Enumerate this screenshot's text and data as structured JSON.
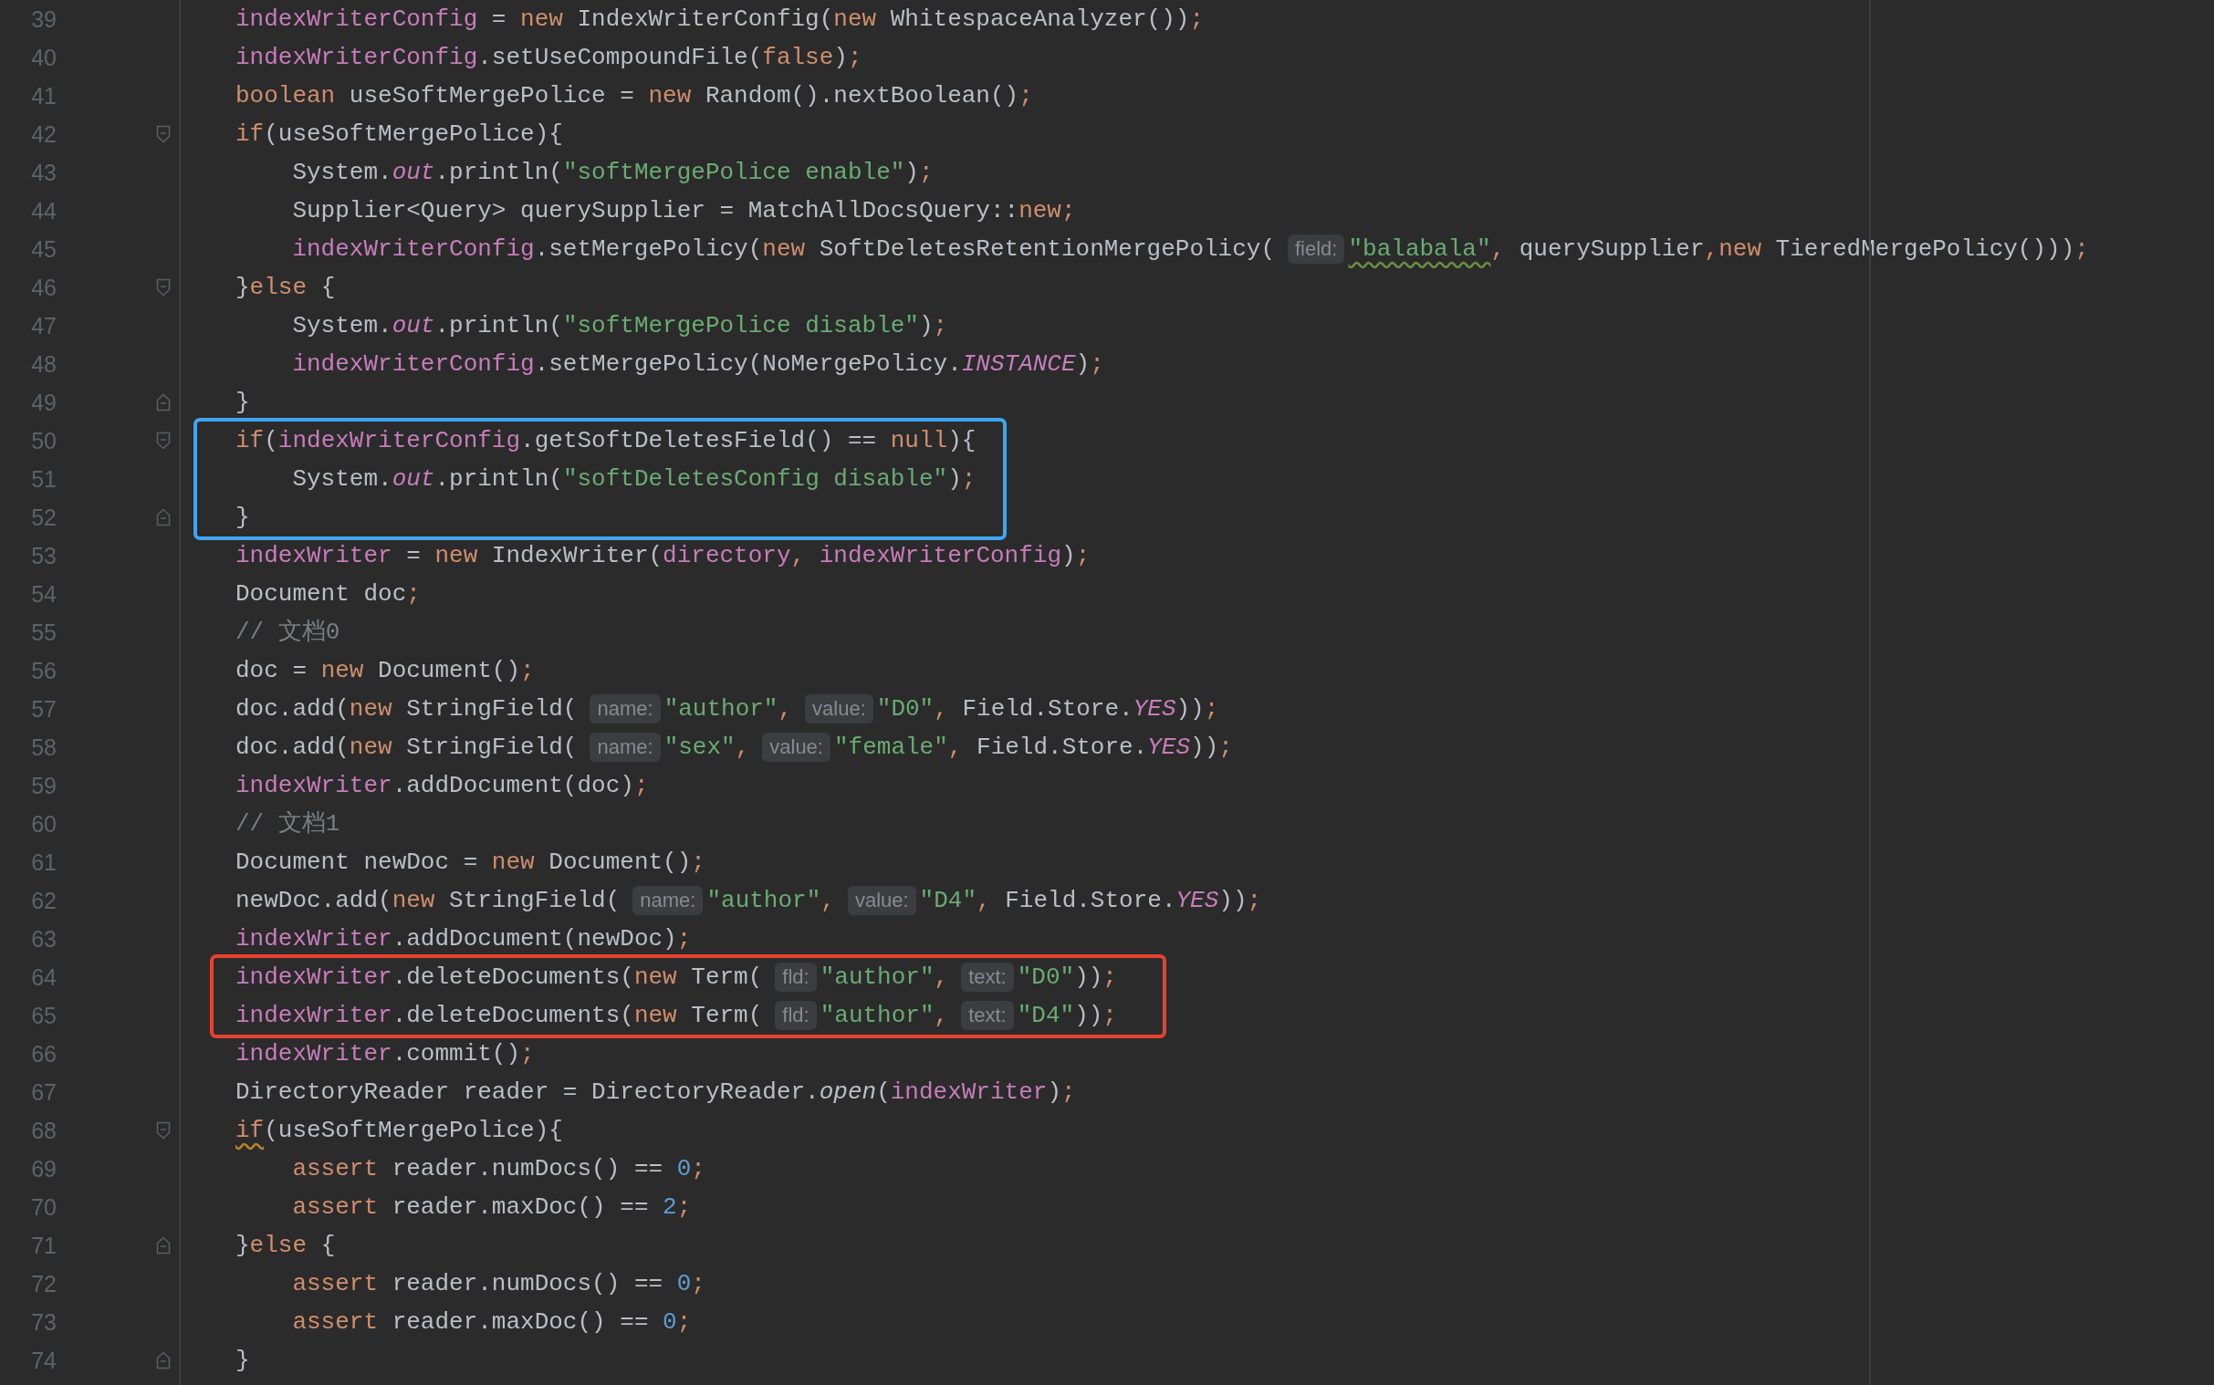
{
  "blocks": [
    {
      "kind": "plain",
      "lines": [
        {
          "number": "39",
          "kind": "code",
          "tokens": [
            {
              "kind": "field",
              "text": "indexWriterConfig"
            },
            {
              "kind": "plain",
              "text": " = "
            },
            {
              "kind": "kw",
              "text": "new"
            },
            {
              "kind": "plain",
              "text": " IndexWriterConfig("
            },
            {
              "kind": "kw",
              "text": "new"
            },
            {
              "kind": "plain",
              "text": " WhitespaceAnalyzer())"
            },
            {
              "kind": "punct",
              "text": ";"
            }
          ]
        },
        {
          "number": "40",
          "kind": "code",
          "tokens": [
            {
              "kind": "field",
              "text": "indexWriterConfig"
            },
            {
              "kind": "plain",
              "text": ".setUseCompoundFile("
            },
            {
              "kind": "kw",
              "text": "false"
            },
            {
              "kind": "plain",
              "text": ")"
            },
            {
              "kind": "punct",
              "text": ";"
            }
          ]
        },
        {
          "number": "41",
          "kind": "code",
          "tokens": [
            {
              "kind": "kw",
              "text": "boolean"
            },
            {
              "kind": "plain",
              "text": " useSoftMergePolice = "
            },
            {
              "kind": "kw",
              "text": "new"
            },
            {
              "kind": "plain",
              "text": " Random().nextBoolean()"
            },
            {
              "kind": "punct",
              "text": ";"
            }
          ]
        },
        {
          "number": "42",
          "kind": "fold_start",
          "tokens": [
            {
              "kind": "kw",
              "text": "if"
            },
            {
              "kind": "plain",
              "text": "(useSoftMergePolice){"
            }
          ]
        },
        {
          "number": "43",
          "kind": "code",
          "tokens": [
            {
              "kind": "plain",
              "text": "    System."
            },
            {
              "kind": "static",
              "text": "out"
            },
            {
              "kind": "plain",
              "text": ".println("
            },
            {
              "kind": "str",
              "text": "\"softMergePolice enable\""
            },
            {
              "kind": "plain",
              "text": ")"
            },
            {
              "kind": "punct",
              "text": ";"
            }
          ]
        },
        {
          "number": "44",
          "kind": "code",
          "tokens": [
            {
              "kind": "plain",
              "text": "    Supplier<Query> querySupplier = MatchAllDocsQuery::"
            },
            {
              "kind": "kw",
              "text": "new"
            },
            {
              "kind": "punct",
              "text": ";"
            }
          ]
        },
        {
          "number": "45",
          "kind": "code",
          "tokens": [
            {
              "kind": "field",
              "text": "    indexWriterConfig"
            },
            {
              "kind": "plain",
              "text": ".setMergePolicy("
            },
            {
              "kind": "kw",
              "text": "new"
            },
            {
              "kind": "plain",
              "text": " SoftDeletesRetentionMergePolicy("
            },
            {
              "kind": "hint",
              "text": "field:"
            },
            {
              "kind": "str_typo",
              "text": "\"balabala\""
            },
            {
              "kind": "punct",
              "text": ", "
            },
            {
              "kind": "plain",
              "text": "querySupplier"
            },
            {
              "kind": "punct",
              "text": ","
            },
            {
              "kind": "kw",
              "text": "new"
            },
            {
              "kind": "plain",
              "text": " TieredMergePolicy()))"
            },
            {
              "kind": "punct",
              "text": ";"
            }
          ]
        },
        {
          "number": "46",
          "kind": "fold_start",
          "tokens": [
            {
              "kind": "plain",
              "text": "}"
            },
            {
              "kind": "kw",
              "text": "else"
            },
            {
              "kind": "plain",
              "text": " {"
            }
          ]
        },
        {
          "number": "47",
          "kind": "code",
          "tokens": [
            {
              "kind": "plain",
              "text": "    System."
            },
            {
              "kind": "static",
              "text": "out"
            },
            {
              "kind": "plain",
              "text": ".println("
            },
            {
              "kind": "str",
              "text": "\"softMergePolice disable\""
            },
            {
              "kind": "plain",
              "text": ")"
            },
            {
              "kind": "punct",
              "text": ";"
            }
          ]
        },
        {
          "number": "48",
          "kind": "code",
          "tokens": [
            {
              "kind": "field",
              "text": "    indexWriterConfig"
            },
            {
              "kind": "plain",
              "text": ".setMergePolicy(NoMergePolicy."
            },
            {
              "kind": "static",
              "text": "INSTANCE"
            },
            {
              "kind": "plain",
              "text": ")"
            },
            {
              "kind": "punct",
              "text": ";"
            }
          ]
        },
        {
          "number": "49",
          "kind": "fold_end",
          "tokens": [
            {
              "kind": "plain",
              "text": "}"
            }
          ]
        }
      ]
    },
    {
      "kind": "highlight",
      "color": "#3ea6f2",
      "lines": [
        {
          "number": "50",
          "kind": "fold_start",
          "tokens": [
            {
              "kind": "kw",
              "text": "if"
            },
            {
              "kind": "plain",
              "text": "("
            },
            {
              "kind": "field",
              "text": "indexWriterConfig"
            },
            {
              "kind": "plain",
              "text": ".getSoftDeletesField() == "
            },
            {
              "kind": "kw",
              "text": "null"
            },
            {
              "kind": "plain",
              "text": "){"
            }
          ]
        },
        {
          "number": "51",
          "kind": "code",
          "tokens": [
            {
              "kind": "plain",
              "text": "    System."
            },
            {
              "kind": "static",
              "text": "out"
            },
            {
              "kind": "plain",
              "text": ".println("
            },
            {
              "kind": "str",
              "text": "\"softDeletesConfig disable\""
            },
            {
              "kind": "plain",
              "text": ")"
            },
            {
              "kind": "punct",
              "text": ";"
            }
          ]
        },
        {
          "number": "52",
          "kind": "fold_end",
          "tokens": [
            {
              "kind": "plain",
              "text": "}"
            }
          ]
        }
      ]
    },
    {
      "kind": "plain",
      "lines": [
        {
          "number": "53",
          "kind": "code",
          "tokens": [
            {
              "kind": "field",
              "text": "indexWriter"
            },
            {
              "kind": "plain",
              "text": " = "
            },
            {
              "kind": "kw",
              "text": "new"
            },
            {
              "kind": "plain",
              "text": " IndexWriter("
            },
            {
              "kind": "field",
              "text": "directory"
            },
            {
              "kind": "punct",
              "text": ", "
            },
            {
              "kind": "field",
              "text": "indexWriterConfig"
            },
            {
              "kind": "plain",
              "text": ")"
            },
            {
              "kind": "punct",
              "text": ";"
            }
          ]
        },
        {
          "number": "54",
          "kind": "code",
          "tokens": [
            {
              "kind": "plain",
              "text": "Document doc"
            },
            {
              "kind": "punct",
              "text": ";"
            }
          ]
        },
        {
          "number": "55",
          "kind": "code",
          "tokens": [
            {
              "kind": "comment",
              "text": "// 文档0"
            }
          ]
        },
        {
          "number": "56",
          "kind": "code",
          "tokens": [
            {
              "kind": "plain",
              "text": "doc = "
            },
            {
              "kind": "kw",
              "text": "new"
            },
            {
              "kind": "plain",
              "text": " Document()"
            },
            {
              "kind": "punct",
              "text": ";"
            }
          ]
        },
        {
          "number": "57",
          "kind": "code",
          "tokens": [
            {
              "kind": "plain",
              "text": "doc.add("
            },
            {
              "kind": "kw",
              "text": "new"
            },
            {
              "kind": "plain",
              "text": " StringField("
            },
            {
              "kind": "hint",
              "text": "name:"
            },
            {
              "kind": "str",
              "text": "\"author\""
            },
            {
              "kind": "punct",
              "text": ","
            },
            {
              "kind": "hint",
              "text": "value:"
            },
            {
              "kind": "str",
              "text": "\"D0\""
            },
            {
              "kind": "punct",
              "text": ", "
            },
            {
              "kind": "plain",
              "text": "Field.Store."
            },
            {
              "kind": "static",
              "text": "YES"
            },
            {
              "kind": "plain",
              "text": "))"
            },
            {
              "kind": "punct",
              "text": ";"
            }
          ]
        },
        {
          "number": "58",
          "kind": "code",
          "tokens": [
            {
              "kind": "plain",
              "text": "doc.add("
            },
            {
              "kind": "kw",
              "text": "new"
            },
            {
              "kind": "plain",
              "text": " StringField("
            },
            {
              "kind": "hint",
              "text": "name:"
            },
            {
              "kind": "str",
              "text": "\"sex\""
            },
            {
              "kind": "punct",
              "text": ","
            },
            {
              "kind": "hint",
              "text": "value:"
            },
            {
              "kind": "str",
              "text": "\"female\""
            },
            {
              "kind": "punct",
              "text": ", "
            },
            {
              "kind": "plain",
              "text": "Field.Store."
            },
            {
              "kind": "static",
              "text": "YES"
            },
            {
              "kind": "plain",
              "text": "))"
            },
            {
              "kind": "punct",
              "text": ";"
            }
          ]
        },
        {
          "number": "59",
          "kind": "code",
          "tokens": [
            {
              "kind": "field",
              "text": "indexWriter"
            },
            {
              "kind": "plain",
              "text": ".addDocument(doc)"
            },
            {
              "kind": "punct",
              "text": ";"
            }
          ]
        },
        {
          "number": "60",
          "kind": "code",
          "tokens": [
            {
              "kind": "comment",
              "text": "// 文档1"
            }
          ]
        },
        {
          "number": "61",
          "kind": "code",
          "tokens": [
            {
              "kind": "plain",
              "text": "Document newDoc = "
            },
            {
              "kind": "kw",
              "text": "new"
            },
            {
              "kind": "plain",
              "text": " Document()"
            },
            {
              "kind": "punct",
              "text": ";"
            }
          ]
        },
        {
          "number": "62",
          "kind": "code",
          "tokens": [
            {
              "kind": "plain",
              "text": "newDoc.add("
            },
            {
              "kind": "kw",
              "text": "new"
            },
            {
              "kind": "plain",
              "text": " StringField("
            },
            {
              "kind": "hint",
              "text": "name:"
            },
            {
              "kind": "str",
              "text": "\"author\""
            },
            {
              "kind": "punct",
              "text": ","
            },
            {
              "kind": "hint",
              "text": "value:"
            },
            {
              "kind": "str",
              "text": "\"D4\""
            },
            {
              "kind": "punct",
              "text": ", "
            },
            {
              "kind": "plain",
              "text": "Field.Store."
            },
            {
              "kind": "static",
              "text": "YES"
            },
            {
              "kind": "plain",
              "text": "))"
            },
            {
              "kind": "punct",
              "text": ";"
            }
          ]
        },
        {
          "number": "63",
          "kind": "code",
          "tokens": [
            {
              "kind": "field",
              "text": "indexWriter"
            },
            {
              "kind": "plain",
              "text": ".addDocument(newDoc)"
            },
            {
              "kind": "punct",
              "text": ";"
            }
          ]
        }
      ]
    },
    {
      "kind": "highlight",
      "color": "#e8422f",
      "lines": [
        {
          "number": "64",
          "kind": "code",
          "tokens": [
            {
              "kind": "field",
              "text": "indexWriter"
            },
            {
              "kind": "plain",
              "text": ".deleteDocuments("
            },
            {
              "kind": "kw",
              "text": "new"
            },
            {
              "kind": "plain",
              "text": " Term("
            },
            {
              "kind": "hint",
              "text": "fld:"
            },
            {
              "kind": "str",
              "text": "\"author\""
            },
            {
              "kind": "punct",
              "text": ","
            },
            {
              "kind": "hint",
              "text": "text:"
            },
            {
              "kind": "str",
              "text": "\"D0\""
            },
            {
              "kind": "plain",
              "text": "))"
            },
            {
              "kind": "punct",
              "text": ";"
            }
          ]
        },
        {
          "number": "65",
          "kind": "code",
          "tokens": [
            {
              "kind": "field",
              "text": "indexWriter"
            },
            {
              "kind": "plain",
              "text": ".deleteDocuments("
            },
            {
              "kind": "kw",
              "text": "new"
            },
            {
              "kind": "plain",
              "text": " Term("
            },
            {
              "kind": "hint",
              "text": "fld:"
            },
            {
              "kind": "str",
              "text": "\"author\""
            },
            {
              "kind": "punct",
              "text": ","
            },
            {
              "kind": "hint",
              "text": "text:"
            },
            {
              "kind": "str",
              "text": "\"D4\""
            },
            {
              "kind": "plain",
              "text": "))"
            },
            {
              "kind": "punct",
              "text": ";"
            }
          ]
        }
      ]
    },
    {
      "kind": "plain",
      "lines": [
        {
          "number": "66",
          "kind": "code",
          "tokens": [
            {
              "kind": "field",
              "text": "indexWriter"
            },
            {
              "kind": "plain",
              "text": ".commit()"
            },
            {
              "kind": "punct",
              "text": ";"
            }
          ]
        },
        {
          "number": "67",
          "kind": "code",
          "tokens": [
            {
              "kind": "plain",
              "text": "DirectoryReader reader = DirectoryReader."
            },
            {
              "kind": "italic",
              "text": "open"
            },
            {
              "kind": "plain",
              "text": "("
            },
            {
              "kind": "field",
              "text": "indexWriter"
            },
            {
              "kind": "plain",
              "text": ")"
            },
            {
              "kind": "punct",
              "text": ";"
            }
          ]
        },
        {
          "number": "68",
          "kind": "fold_start",
          "tokens": [
            {
              "kind": "kw_warn",
              "text": "if"
            },
            {
              "kind": "plain",
              "text": "(useSoftMergePolice){"
            }
          ]
        },
        {
          "number": "69",
          "kind": "code",
          "tokens": [
            {
              "kind": "kw",
              "text": "    assert"
            },
            {
              "kind": "plain",
              "text": " reader.numDocs() == "
            },
            {
              "kind": "num",
              "text": "0"
            },
            {
              "kind": "punct",
              "text": ";"
            }
          ]
        },
        {
          "number": "70",
          "kind": "code",
          "tokens": [
            {
              "kind": "kw",
              "text": "    assert"
            },
            {
              "kind": "plain",
              "text": " reader.maxDoc() == "
            },
            {
              "kind": "num",
              "text": "2"
            },
            {
              "kind": "punct",
              "text": ";"
            }
          ]
        },
        {
          "number": "71",
          "kind": "fold_end",
          "tokens": [
            {
              "kind": "plain",
              "text": "}"
            },
            {
              "kind": "kw",
              "text": "else"
            },
            {
              "kind": "plain",
              "text": " {"
            }
          ]
        },
        {
          "number": "72",
          "kind": "code",
          "tokens": [
            {
              "kind": "kw",
              "text": "    assert"
            },
            {
              "kind": "plain",
              "text": " reader.numDocs() == "
            },
            {
              "kind": "num",
              "text": "0"
            },
            {
              "kind": "punct",
              "text": ";"
            }
          ]
        },
        {
          "number": "73",
          "kind": "code",
          "tokens": [
            {
              "kind": "kw",
              "text": "    assert"
            },
            {
              "kind": "plain",
              "text": " reader.maxDoc() == "
            },
            {
              "kind": "num",
              "text": "0"
            },
            {
              "kind": "punct",
              "text": ";"
            }
          ]
        },
        {
          "number": "74",
          "kind": "fold_end",
          "tokens": [
            {
              "kind": "plain",
              "text": "}"
            }
          ]
        }
      ]
    }
  ]
}
